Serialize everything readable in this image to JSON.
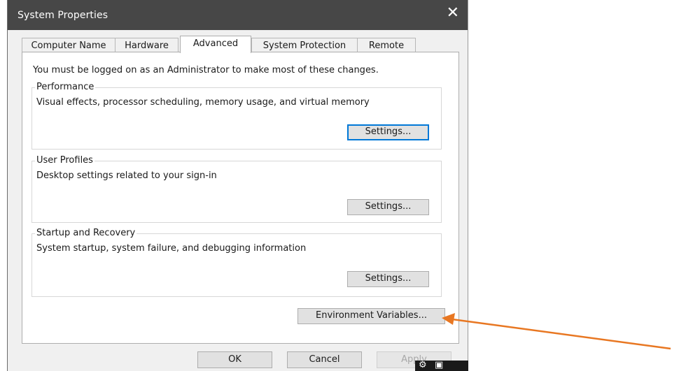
{
  "window": {
    "title": "System Properties",
    "close_glyph": "✕"
  },
  "tabs": [
    {
      "label": "Computer Name",
      "active": false
    },
    {
      "label": "Hardware",
      "active": false
    },
    {
      "label": "Advanced",
      "active": true
    },
    {
      "label": "System Protection",
      "active": false
    },
    {
      "label": "Remote",
      "active": false
    }
  ],
  "notice": "You must be logged on as an Administrator to make most of these changes.",
  "groups": {
    "performance": {
      "legend": "Performance",
      "description": "Visual effects, processor scheduling, memory usage, and virtual memory",
      "button": "Settings..."
    },
    "user_profiles": {
      "legend": "User Profiles",
      "description": "Desktop settings related to your sign-in",
      "button": "Settings..."
    },
    "startup": {
      "legend": "Startup and Recovery",
      "description": "System startup, system failure, and debugging information",
      "button": "Settings..."
    }
  },
  "env_button": "Environment Variables...",
  "footer": {
    "ok": "OK",
    "cancel": "Cancel",
    "apply": "Apply"
  },
  "icons": {
    "close": "close-icon",
    "annotation": "arrow-annotation-icon",
    "overlay": "camera-icon"
  },
  "colors": {
    "titlebar": "#474747",
    "arrow": "#e87722",
    "focus": "#0078d7"
  }
}
